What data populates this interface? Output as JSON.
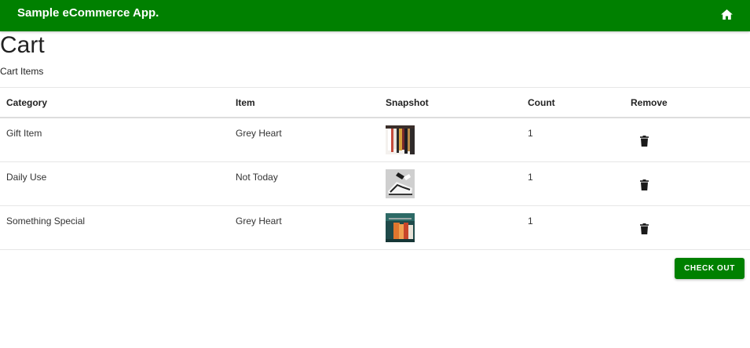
{
  "appbar": {
    "title": "Sample eCommerce App.",
    "home_icon": "home-icon",
    "color": "#008000"
  },
  "page": {
    "title": "Cart",
    "subtitle": "Cart Items"
  },
  "table": {
    "headers": {
      "category": "Category",
      "item": "Item",
      "snapshot": "Snapshot",
      "count": "Count",
      "remove": "Remove"
    },
    "rows": [
      {
        "category": "Gift Item",
        "item": "Grey Heart",
        "snapshot": "clothing-rack-thumbnail",
        "count": "1",
        "remove_icon": "trash-icon"
      },
      {
        "category": "Daily Use",
        "item": "Not Today",
        "snapshot": "sneakers-thumbnail",
        "count": "1",
        "remove_icon": "trash-icon"
      },
      {
        "category": "Something Special",
        "item": "Grey Heart",
        "snapshot": "shop-clothes-thumbnail",
        "count": "1",
        "remove_icon": "trash-icon"
      }
    ]
  },
  "checkout": {
    "label": "CHECK OUT"
  }
}
